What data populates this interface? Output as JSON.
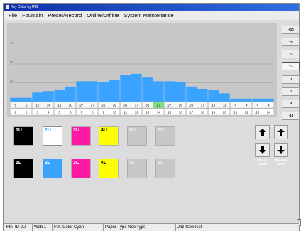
{
  "window": {
    "title": "Key Color by IPG"
  },
  "menu": [
    "File",
    "Fountain",
    "Preset/Record",
    "Online/Offline",
    "System Maintenance"
  ],
  "chart_data": {
    "type": "bar",
    "categories": [
      "1",
      "2",
      "3",
      "4",
      "5",
      "6",
      "7",
      "8",
      "9",
      "10",
      "11",
      "12",
      "13",
      "14",
      "15",
      "16",
      "17",
      "18",
      "19",
      "20",
      "21",
      "22",
      "23",
      "24"
    ],
    "values": [
      5,
      5,
      12,
      14,
      16,
      20,
      27,
      27,
      26,
      29,
      35,
      37,
      32,
      27,
      27,
      26,
      20,
      17,
      15,
      11,
      4,
      4,
      4,
      4
    ],
    "value_labels": [
      "5",
      "5",
      "12",
      "14",
      "16",
      "20",
      "27",
      "27",
      "26",
      "29",
      "35",
      "37",
      "32",
      "27",
      "27",
      "26",
      "20",
      "17",
      "15",
      "11",
      "4",
      "4",
      "4",
      "4"
    ],
    "ylim": [
      0,
      100
    ],
    "yticks": [
      25,
      50,
      75
    ],
    "grid": true,
    "bar_color": "#3aa3ff",
    "highlight_index": 13,
    "highlight_color": "#7fe07f"
  },
  "step_buttons": [
    {
      "label": "+10",
      "active": false
    },
    {
      "label": "+5",
      "active": false
    },
    {
      "label": "+3",
      "active": false
    },
    {
      "label": "+1",
      "active": true
    },
    {
      "label": "-1",
      "active": false
    },
    {
      "label": "-3",
      "active": false
    },
    {
      "label": "-5",
      "active": false
    },
    {
      "label": "-10",
      "active": false
    }
  ],
  "units_upper": [
    {
      "label": "1U",
      "color": "black"
    },
    {
      "label": "2U",
      "color": "white"
    },
    {
      "label": "3U",
      "color": "magenta"
    },
    {
      "label": "4U",
      "color": "yellow"
    },
    {
      "label": "5U",
      "color": "empty"
    },
    {
      "label": "6U",
      "color": "empty"
    }
  ],
  "units_lower": [
    {
      "label": "1L",
      "color": "black"
    },
    {
      "label": "2L",
      "color": "cyan"
    },
    {
      "label": "3L",
      "color": "magenta"
    },
    {
      "label": "4L",
      "color": "yellow"
    },
    {
      "label": "5L",
      "color": "empty"
    },
    {
      "label": "6L",
      "color": "empty"
    }
  ],
  "move": {
    "block_label": "Block Move",
    "percent_label": "Percent Move",
    "up_icon": "arrow-up-icon",
    "down_icon": "arrow-down-icon"
  },
  "status": {
    "ftn_id": "Ftn. ID  2U",
    "web": "Web  1",
    "ftn_color": "Ftn. Color  Cyan",
    "paper_type": "Paper Type  NewType",
    "job": "Job NewTest"
  }
}
